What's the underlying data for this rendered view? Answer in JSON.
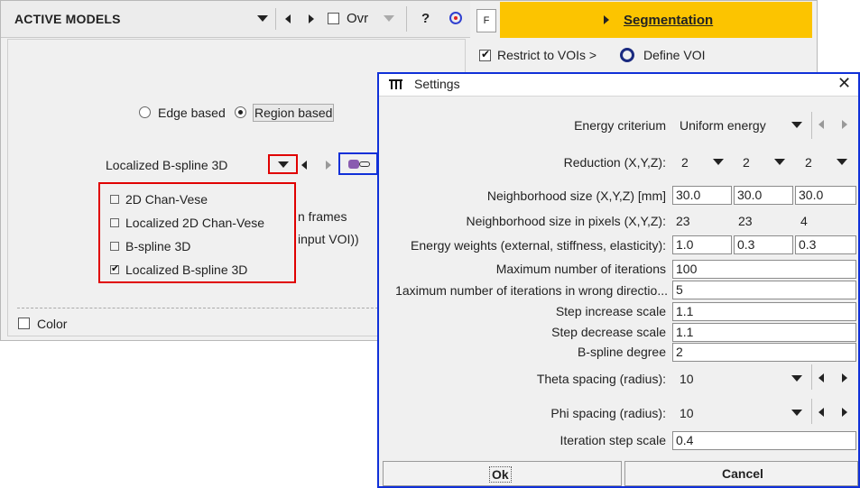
{
  "main": {
    "title": "ACTIVE MODELS",
    "ovr_label": "Ovr",
    "help_label": "?",
    "f_label": "F",
    "segmentation_label": "Segmentation",
    "restrict_label": "Restrict to VOIs >",
    "define_voi_label": "Define VOI",
    "edge_based_label": "Edge based",
    "region_based_label": "Region based",
    "model_selected": "Localized B-spline 3D",
    "model_options": [
      "2D Chan-Vese",
      "Localized 2D Chan-Vese",
      "B-spline 3D",
      "Localized B-spline 3D"
    ],
    "frames_text": "n frames",
    "input_voi_text": "input VOI))",
    "color_label": "Color"
  },
  "dialog": {
    "title": "Settings",
    "energy_label": "Energy criterium",
    "energy_value": "Uniform energy",
    "reduction_label": "Reduction (X,Y,Z):",
    "reduction_values": [
      "2",
      "2",
      "2"
    ],
    "neigh_size_label": "Neighborhood size (X,Y,Z) [mm]",
    "neigh_size_values": [
      "30.0",
      "30.0",
      "30.0"
    ],
    "neigh_pixels_label": "Neighborhood size in pixels (X,Y,Z):",
    "neigh_pixels_values": [
      "23",
      "23",
      "4"
    ],
    "energy_weights_label": "Energy weights (external, stiffness, elasticity):",
    "energy_weights_values": [
      "1.0",
      "0.3",
      "0.3"
    ],
    "max_iter_label": "Maximum number of iterations",
    "max_iter_value": "100",
    "max_iter_wrong_label": "1aximum number of iterations in wrong directio...",
    "max_iter_wrong_value": "5",
    "step_inc_label": "Step increase scale",
    "step_inc_value": "1.1",
    "step_dec_label": "Step decrease scale",
    "step_dec_value": "1.1",
    "bspline_label": "B-spline degree",
    "bspline_value": "2",
    "theta_label": "Theta spacing (radius):",
    "theta_value": "10",
    "phi_label": "Phi spacing (radius):",
    "phi_value": "10",
    "iter_step_label": "Iteration step scale",
    "iter_step_value": "0.4",
    "ok_label": "Ok",
    "cancel_label": "Cancel"
  },
  "colors": {
    "segmentation_bg": "#fcc400",
    "highlight_red": "#e00000",
    "highlight_blue": "#1030d8"
  }
}
